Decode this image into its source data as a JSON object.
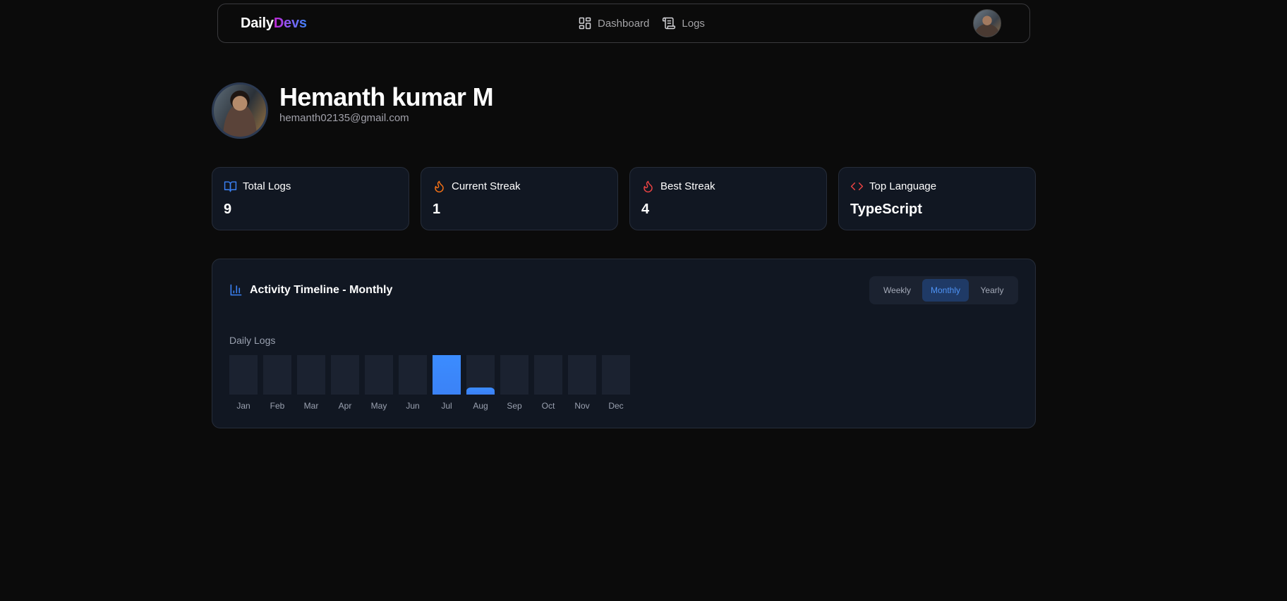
{
  "brand": {
    "part1": "Daily",
    "part2": "Devs"
  },
  "nav": {
    "links": [
      {
        "label": "Dashboard",
        "icon": "dashboard-icon"
      },
      {
        "label": "Logs",
        "icon": "scroll-icon"
      }
    ],
    "avatar_icon": "user-avatar"
  },
  "profile": {
    "name": "Hemanth kumar M",
    "email": "hemanth02135@gmail.com"
  },
  "stats": [
    {
      "label": "Total Logs",
      "value": "9",
      "icon": "book-open-icon",
      "color": "#3b82f6"
    },
    {
      "label": "Current Streak",
      "value": "1",
      "icon": "flame-icon",
      "color": "#f97316"
    },
    {
      "label": "Best Streak",
      "value": "4",
      "icon": "flame-icon",
      "color": "#ef4444"
    },
    {
      "label": "Top Language",
      "value": "TypeScript",
      "icon": "code-icon",
      "color": "#ef4444"
    }
  ],
  "activity": {
    "title": "Activity Timeline - Monthly",
    "toggle": [
      {
        "label": "Weekly",
        "active": false
      },
      {
        "label": "Monthly",
        "active": true
      },
      {
        "label": "Yearly",
        "active": false
      }
    ],
    "chart_label": "Daily Logs"
  },
  "chart_data": {
    "type": "bar",
    "categories": [
      "Jan",
      "Feb",
      "Mar",
      "Apr",
      "May",
      "Jun",
      "Jul",
      "Aug",
      "Sep",
      "Oct",
      "Nov",
      "Dec"
    ],
    "values": [
      0,
      0,
      0,
      0,
      0,
      0,
      8,
      1,
      0,
      0,
      0,
      0
    ],
    "ylim": [
      0,
      8
    ],
    "bar_color": "#3b82f6",
    "track_color": "#1b2230"
  }
}
